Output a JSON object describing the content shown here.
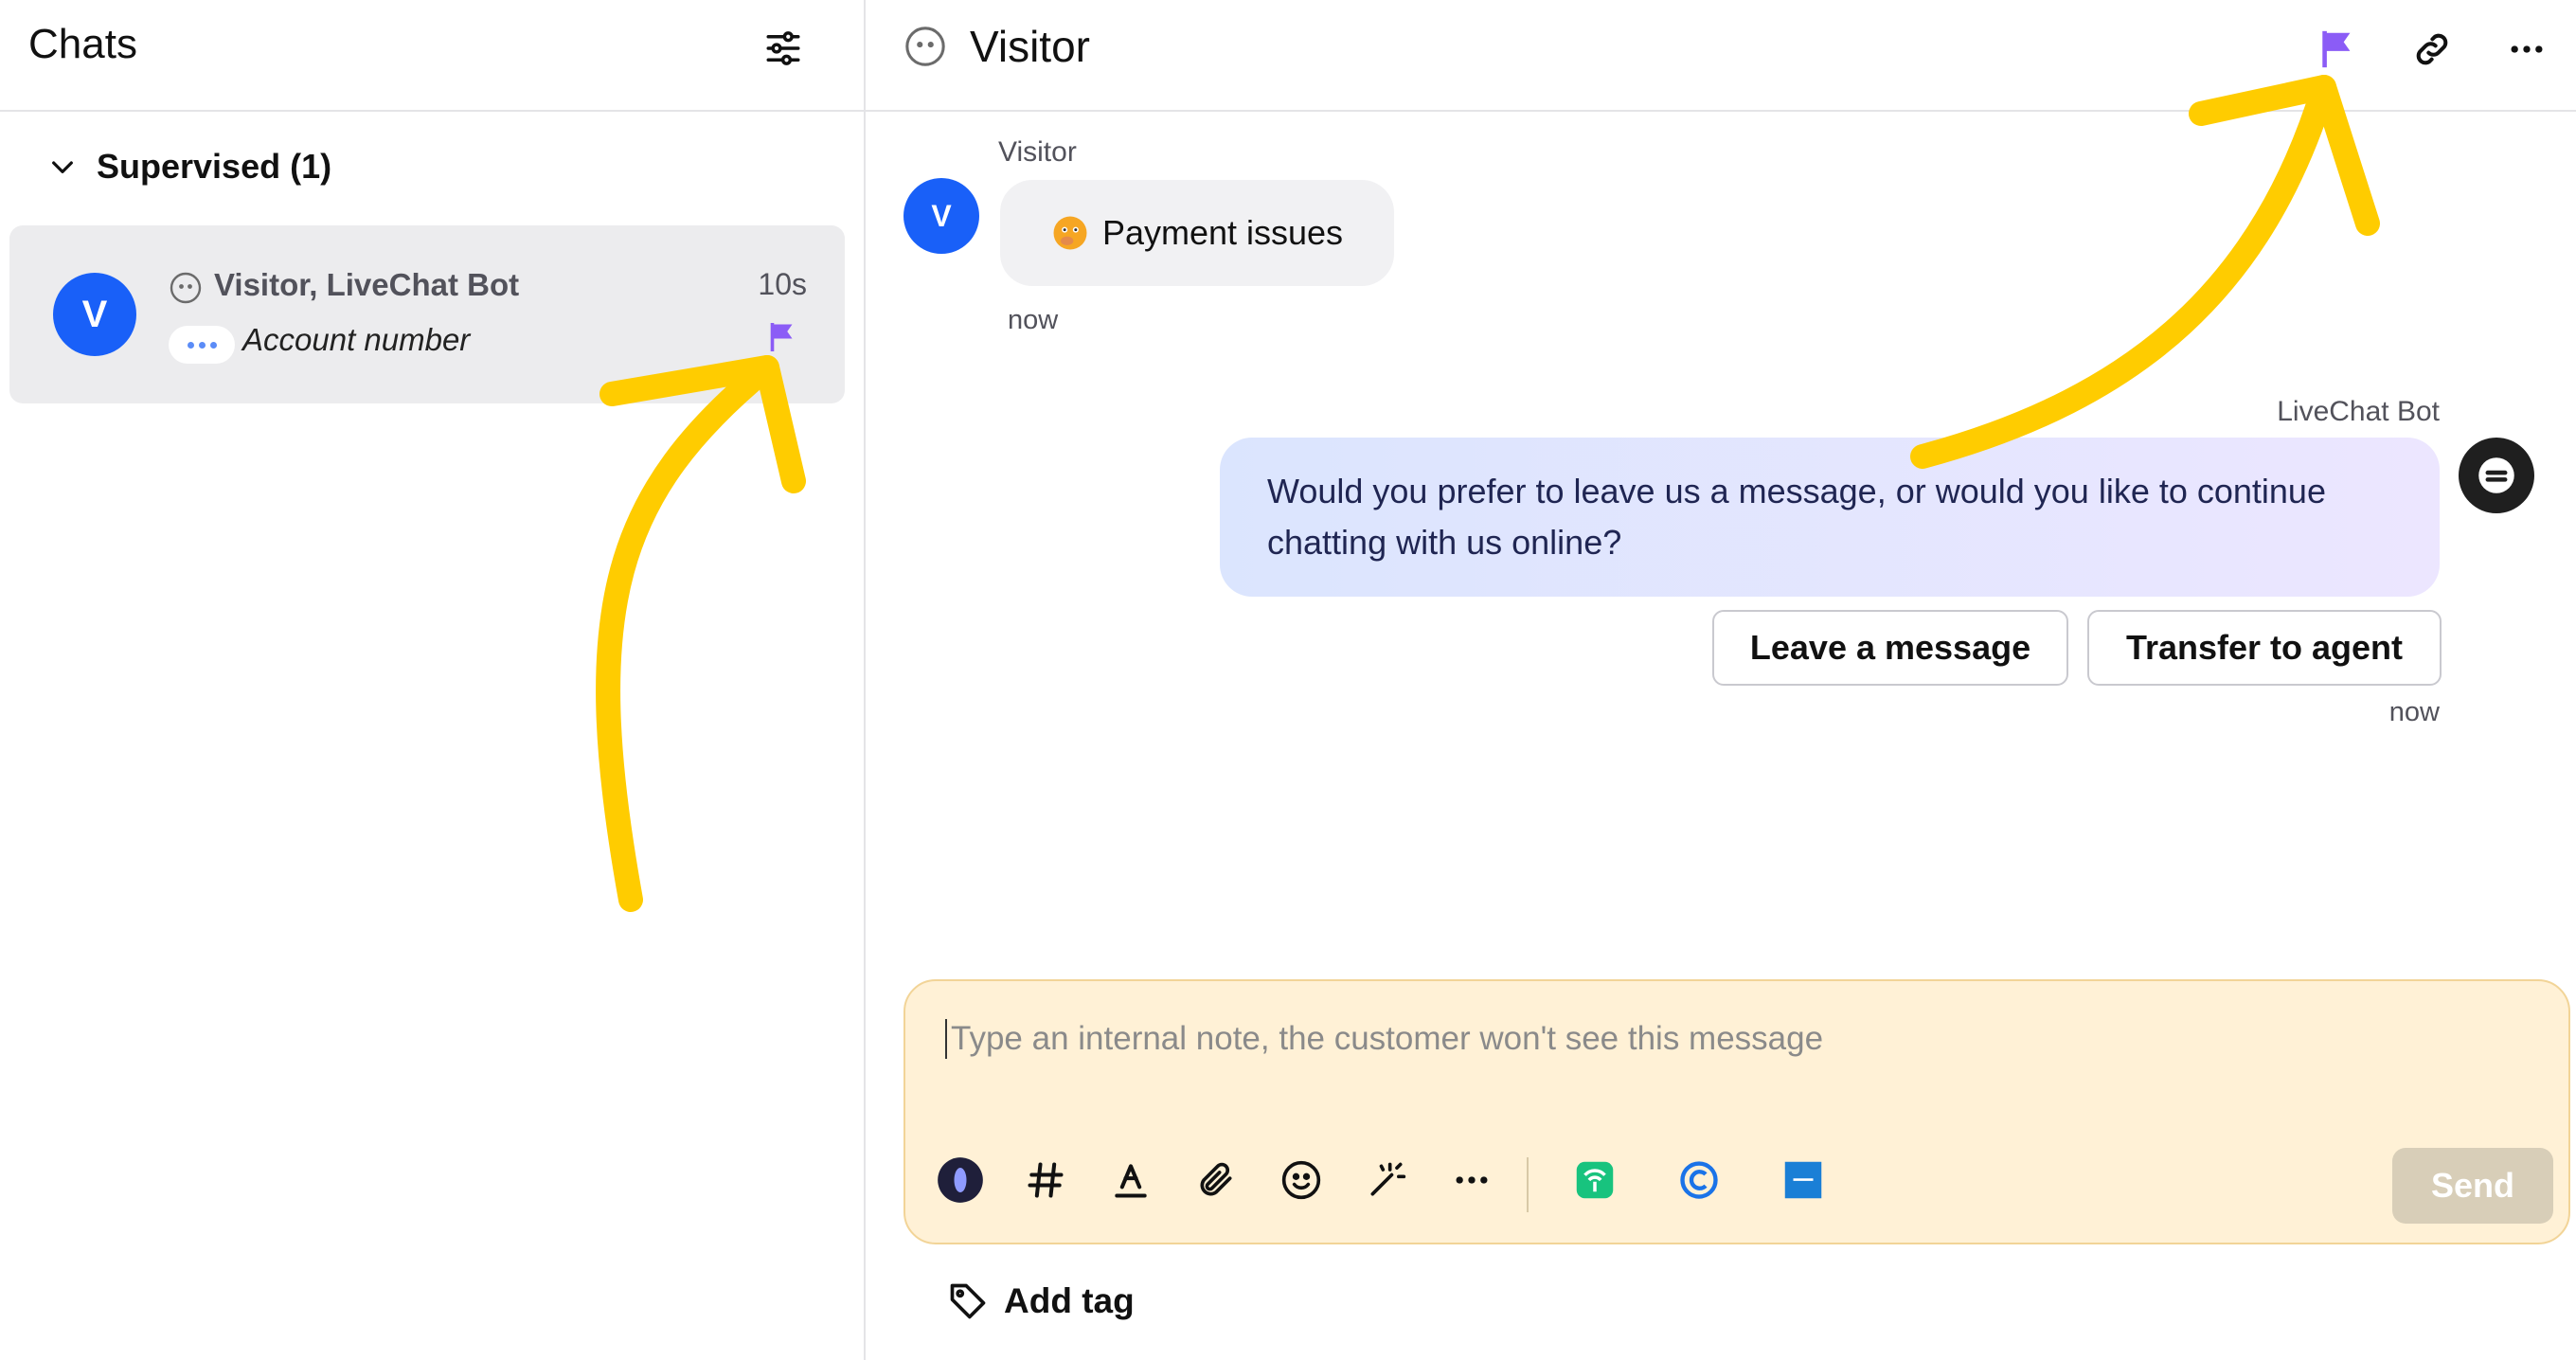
{
  "sidebar": {
    "title": "Chats",
    "section_label": "Supervised (1)",
    "chat": {
      "avatar_letter": "V",
      "name": "Visitor, LiveChat Bot",
      "time": "10s",
      "preview": "Account number",
      "flag_color": "#8b5cf6"
    }
  },
  "header": {
    "title": "Visitor",
    "icons": [
      "flag-icon",
      "link-icon",
      "more-icon"
    ]
  },
  "messages": {
    "visitor": {
      "sender": "Visitor",
      "avatar_letter": "V",
      "text": "Payment issues",
      "time": "now"
    },
    "bot": {
      "sender": "LiveChat Bot",
      "text": "Would you prefer to leave us a message, or would you like to continue chatting with us online?",
      "time": "now",
      "buttons": [
        "Leave a message",
        "Transfer to agent"
      ]
    }
  },
  "composer": {
    "placeholder": "Type an internal note, the customer won't see this message",
    "send_label": "Send",
    "toolbar_icons": [
      "ai-assistant-icon",
      "hashtag-icon",
      "text-format-icon",
      "paperclip-icon",
      "emoji-icon",
      "magic-wand-icon",
      "more-icon",
      "integration-green-icon",
      "integration-blue-c-icon",
      "tenor-icon"
    ]
  },
  "add_tag_label": "Add tag",
  "colors": {
    "accent": "#1960f8",
    "flag": "#8b5cf6",
    "annotation_arrow": "#ffcc00",
    "composer_bg": "#fff1d6"
  }
}
